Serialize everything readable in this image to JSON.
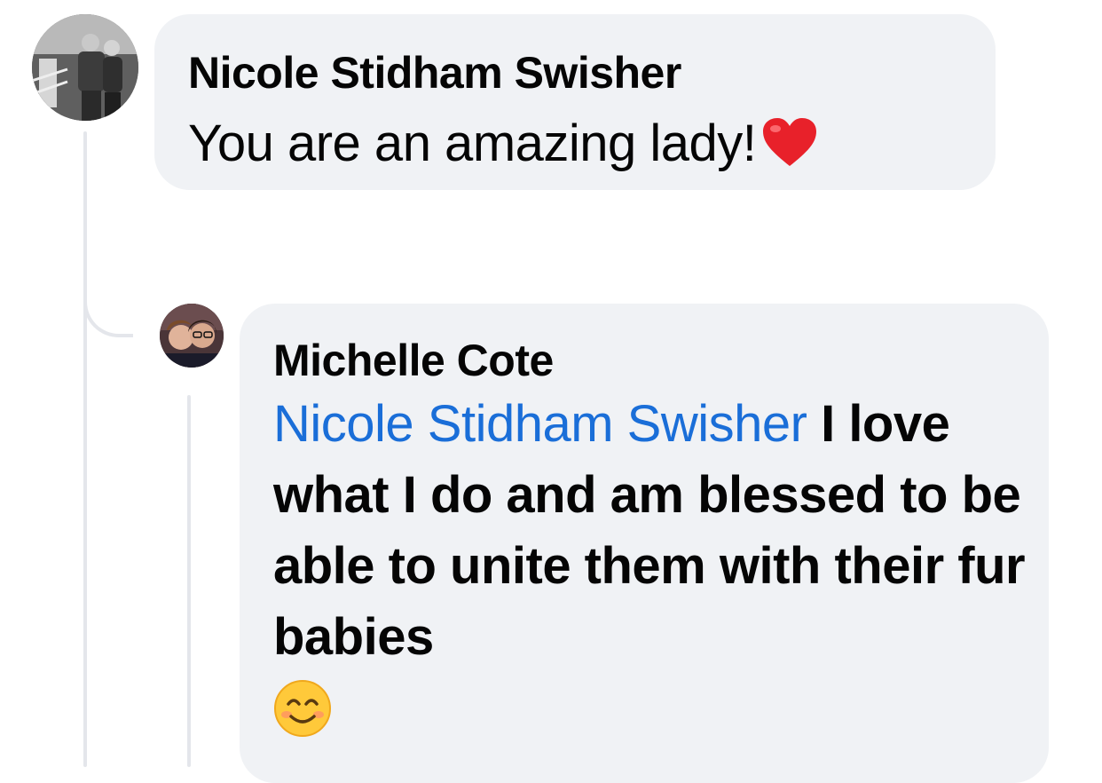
{
  "comments": [
    {
      "author": "Nicole Stidham Swisher",
      "text": "You are an amazing lady!",
      "trailing_emoji": "red-heart"
    },
    {
      "author": "Michelle Cote",
      "mention": "Nicole Stidham Swisher",
      "text": "I love what I do and am blessed to be able to unite them with their fur babies",
      "trailing_emoji": "smiling-face"
    }
  ],
  "colors": {
    "bubble_background": "#f0f2f5",
    "mention_link": "#1a6ed8",
    "text": "#050505",
    "thread_line": "#e4e6eb"
  }
}
